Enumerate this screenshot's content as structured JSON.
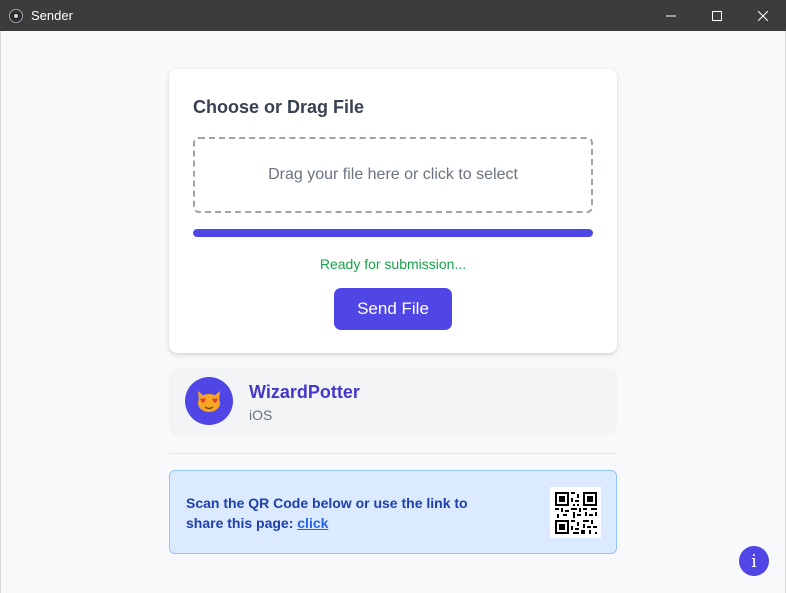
{
  "window": {
    "title": "Sender"
  },
  "upload": {
    "heading": "Choose or Drag File",
    "dropzone_text": "Drag your file here or click to select",
    "progress": 1.0,
    "status": "Ready for submission...",
    "send_label": "Send File"
  },
  "device": {
    "name": "WizardPotter",
    "os": "iOS",
    "avatar_icon": "heart-eyes-cat-icon"
  },
  "share": {
    "text": "Scan the QR Code below or use the link to share this page:",
    "link_label": "click",
    "qr_icon": "qr-code-icon"
  },
  "info": {
    "label": "i"
  },
  "colors": {
    "accent": "#4f46e5",
    "status_ok": "#16a34a",
    "share_bg": "#dbeafe",
    "share_text": "#1e40af",
    "titlebar_bg": "#3c3c3c"
  }
}
